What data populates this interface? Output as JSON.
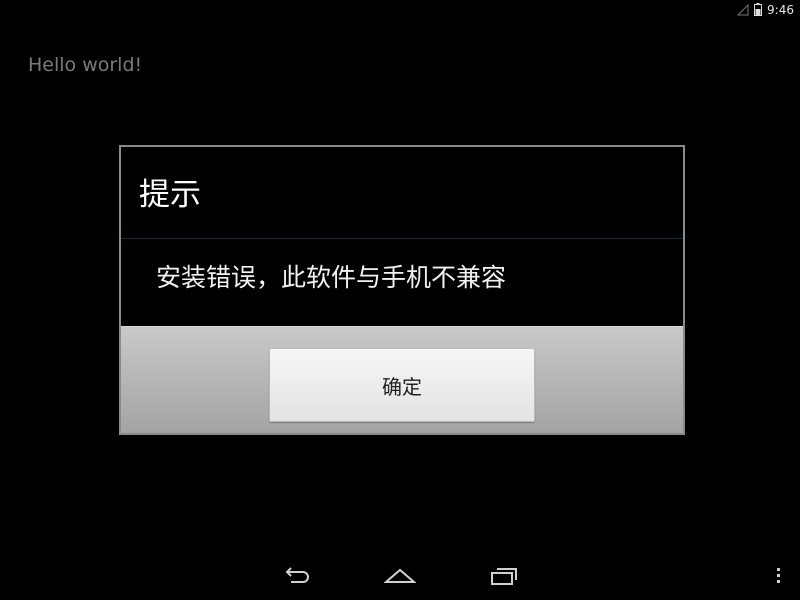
{
  "status_bar": {
    "time": "9:46"
  },
  "app": {
    "hello_text": "Hello world!"
  },
  "dialog": {
    "title": "提示",
    "message": "安装错误，此软件与手机不兼容",
    "ok_label": "确定"
  },
  "nav": {
    "back_icon": "back-icon",
    "home_icon": "home-icon",
    "recents_icon": "recents-icon",
    "menu_icon": "overflow-menu-icon"
  }
}
